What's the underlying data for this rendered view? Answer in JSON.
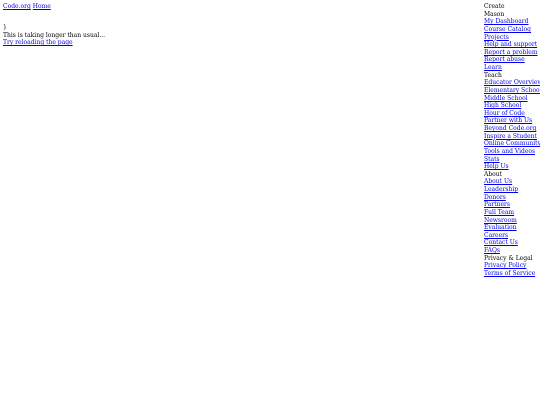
{
  "header": {
    "logo_alt": "Code.org",
    "home_link": "Home"
  },
  "body": {
    "brace": "}",
    "loading_text": "This is taking longer than usual...",
    "reload_link": "Try reloading the page"
  },
  "menu": {
    "create": {
      "label": "Create",
      "user": "Mason",
      "items": [
        "My Dashboard",
        "Course Catalog",
        "Projects",
        "Help and support",
        "Report a problem",
        "Report abuse"
      ]
    },
    "learn": {
      "label": "Learn"
    },
    "teach": {
      "label": "Teach",
      "items": [
        "Educator Overview",
        "Elementary School",
        "Middle School",
        "High School",
        "Hour of Code",
        "Partner with Us",
        "Beyond Code.org",
        "Inspire a Student",
        "Online Community",
        "Tools and Videos",
        "Stats",
        "Help Us"
      ]
    },
    "about": {
      "label": "About",
      "items": [
        "About Us",
        "Leadership",
        "Donors",
        "Partners",
        "Full Team",
        "Newsroom",
        "Evaluation",
        "Careers",
        "Contact Us",
        "FAQs"
      ]
    },
    "legal": {
      "label": "Privacy & Legal",
      "items": [
        "Privacy Policy",
        "Terms of Service"
      ]
    }
  }
}
